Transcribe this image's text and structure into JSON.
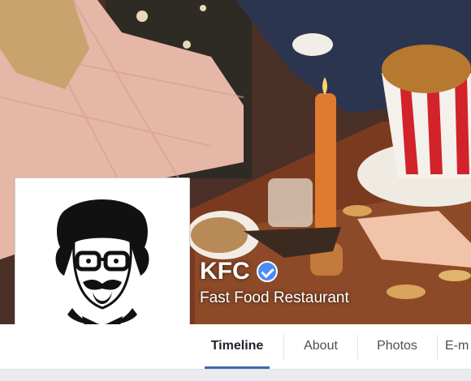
{
  "page": {
    "name": "KFC",
    "category": "Fast Food Restaurant",
    "verified_icon": "verified-check-icon"
  },
  "tabs": [
    {
      "label": "Timeline",
      "active": true
    },
    {
      "label": "About",
      "active": false
    },
    {
      "label": "Photos",
      "active": false
    },
    {
      "label": "E-m",
      "active": false
    }
  ],
  "colors": {
    "accent": "#4267b2",
    "verified": "#4c8bf5",
    "kfc_red": "#d2232a"
  }
}
